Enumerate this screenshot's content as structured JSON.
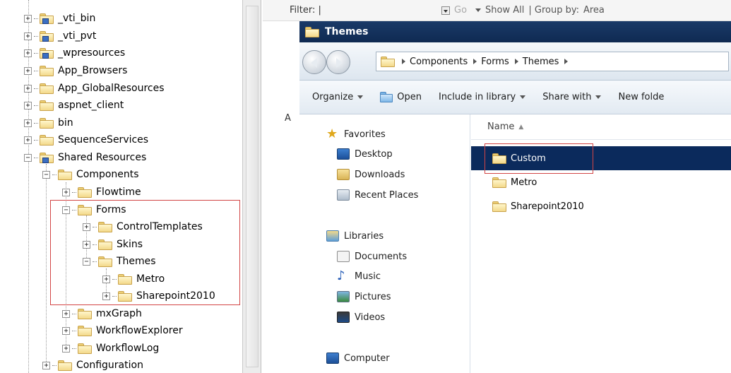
{
  "tree": {
    "items": [
      {
        "label": "_vti_bin",
        "special": true
      },
      {
        "label": "_vti_pvt",
        "special": true
      },
      {
        "label": "_wpresources",
        "special": true
      },
      {
        "label": "App_Browsers",
        "special": false
      },
      {
        "label": "App_GlobalResources",
        "special": false
      },
      {
        "label": "aspnet_client",
        "special": false
      },
      {
        "label": "bin",
        "special": false
      },
      {
        "label": "SequenceServices",
        "special": false
      },
      {
        "label": "Shared Resources",
        "special": true
      },
      {
        "label": "Components",
        "special": false
      },
      {
        "label": "Flowtime",
        "special": false
      },
      {
        "label": "Forms",
        "special": false
      },
      {
        "label": "ControlTemplates",
        "special": false
      },
      {
        "label": "Skins",
        "special": false
      },
      {
        "label": "Themes",
        "special": false
      },
      {
        "label": "Metro",
        "special": false
      },
      {
        "label": "Sharepoint2010",
        "special": false
      },
      {
        "label": "mxGraph",
        "special": false
      },
      {
        "label": "WorkflowExplorer",
        "special": false
      },
      {
        "label": "WorkflowLog",
        "special": false
      },
      {
        "label": "Configuration",
        "special": false
      }
    ],
    "expand_plus": "+",
    "expand_minus": "−"
  },
  "filterbar": {
    "filter_label": "Filter: |",
    "go_label": "Go",
    "show_all_label": "Show All",
    "group_by_label": "| Group by:",
    "group_by_value": "Area",
    "side_letter_a": "A"
  },
  "explorer": {
    "title": "Themes",
    "breadcrumb": [
      "Components",
      "Forms",
      "Themes"
    ],
    "commands": {
      "organize": "Organize",
      "open": "Open",
      "include_in_library": "Include in library",
      "share_with": "Share with",
      "new_folder": "New folde"
    },
    "nav": {
      "favorites": "Favorites",
      "desktop": "Desktop",
      "downloads": "Downloads",
      "recent_places": "Recent Places",
      "libraries": "Libraries",
      "documents": "Documents",
      "music": "Music",
      "pictures": "Pictures",
      "videos": "Videos",
      "computer": "Computer"
    },
    "column_name": "Name",
    "files": [
      "Custom",
      "Metro",
      "Sharepoint2010"
    ],
    "selected_file": "Custom"
  },
  "colors": {
    "highlight_box": "#d24545",
    "selection": "#0b2a5c",
    "titlebar": "#0f2a52"
  }
}
